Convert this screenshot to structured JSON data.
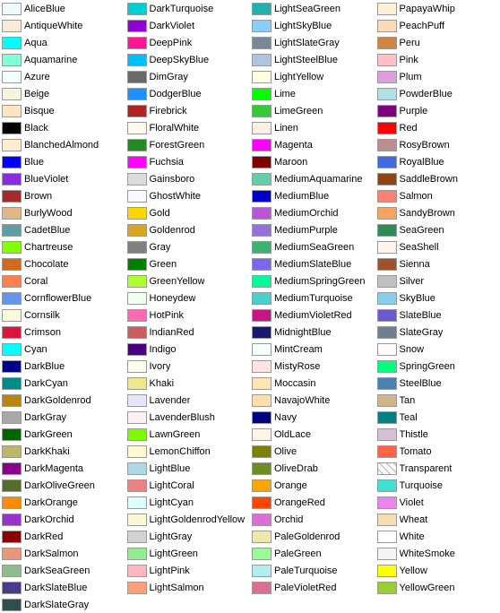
{
  "columns": [
    [
      {
        "name": "AliceBlue",
        "color": "#F0F8FF"
      },
      {
        "name": "AntiqueWhite",
        "color": "#FAEBD7"
      },
      {
        "name": "Aqua",
        "color": "#00FFFF"
      },
      {
        "name": "Aquamarine",
        "color": "#7FFFD4"
      },
      {
        "name": "Azure",
        "color": "#F0FFFF"
      },
      {
        "name": "Beige",
        "color": "#F5F5DC"
      },
      {
        "name": "Bisque",
        "color": "#FFE4C4"
      },
      {
        "name": "Black",
        "color": "#000000"
      },
      {
        "name": "BlanchedAlmond",
        "color": "#FFEBCD"
      },
      {
        "name": "Blue",
        "color": "#0000FF"
      },
      {
        "name": "BlueViolet",
        "color": "#8A2BE2"
      },
      {
        "name": "Brown",
        "color": "#A52A2A"
      },
      {
        "name": "BurlyWood",
        "color": "#DEB887"
      },
      {
        "name": "CadetBlue",
        "color": "#5F9EA0"
      },
      {
        "name": "Chartreuse",
        "color": "#7FFF00"
      },
      {
        "name": "Chocolate",
        "color": "#D2691E"
      },
      {
        "name": "Coral",
        "color": "#FF7F50"
      },
      {
        "name": "CornflowerBlue",
        "color": "#6495ED"
      },
      {
        "name": "Cornsilk",
        "color": "#FFF8DC"
      },
      {
        "name": "Crimson",
        "color": "#DC143C"
      },
      {
        "name": "Cyan",
        "color": "#00FFFF"
      },
      {
        "name": "DarkBlue",
        "color": "#00008B"
      },
      {
        "name": "DarkCyan",
        "color": "#008B8B"
      },
      {
        "name": "DarkGoldenrod",
        "color": "#B8860B"
      },
      {
        "name": "DarkGray",
        "color": "#A9A9A9"
      },
      {
        "name": "DarkGreen",
        "color": "#006400"
      },
      {
        "name": "DarkKhaki",
        "color": "#BDB76B"
      },
      {
        "name": "DarkMagenta",
        "color": "#8B008B"
      },
      {
        "name": "DarkOliveGreen",
        "color": "#556B2F"
      },
      {
        "name": "DarkOrange",
        "color": "#FF8C00"
      },
      {
        "name": "DarkOrchid",
        "color": "#9932CC"
      },
      {
        "name": "DarkRed",
        "color": "#8B0000"
      },
      {
        "name": "DarkSalmon",
        "color": "#E9967A"
      },
      {
        "name": "DarkSeaGreen",
        "color": "#8FBC8F"
      },
      {
        "name": "DarkSlateBlue",
        "color": "#483D8B"
      },
      {
        "name": "DarkSlateGray",
        "color": "#2F4F4F"
      }
    ],
    [
      {
        "name": "DarkTurquoise",
        "color": "#00CED1"
      },
      {
        "name": "DarkViolet",
        "color": "#9400D3"
      },
      {
        "name": "DeepPink",
        "color": "#FF1493"
      },
      {
        "name": "DeepSkyBlue",
        "color": "#00BFFF"
      },
      {
        "name": "DimGray",
        "color": "#696969"
      },
      {
        "name": "DodgerBlue",
        "color": "#1E90FF"
      },
      {
        "name": "Firebrick",
        "color": "#B22222"
      },
      {
        "name": "FloralWhite",
        "color": "#FFFAF0"
      },
      {
        "name": "ForestGreen",
        "color": "#228B22"
      },
      {
        "name": "Fuchsia",
        "color": "#FF00FF"
      },
      {
        "name": "Gainsboro",
        "color": "#DCDCDC"
      },
      {
        "name": "GhostWhite",
        "color": "#F8F8FF"
      },
      {
        "name": "Gold",
        "color": "#FFD700"
      },
      {
        "name": "Goldenrod",
        "color": "#DAA520"
      },
      {
        "name": "Gray",
        "color": "#808080"
      },
      {
        "name": "Green",
        "color": "#008000"
      },
      {
        "name": "GreenYellow",
        "color": "#ADFF2F"
      },
      {
        "name": "Honeydew",
        "color": "#F0FFF0"
      },
      {
        "name": "HotPink",
        "color": "#FF69B4"
      },
      {
        "name": "IndianRed",
        "color": "#CD5C5C"
      },
      {
        "name": "Indigo",
        "color": "#4B0082"
      },
      {
        "name": "Ivory",
        "color": "#FFFFF0"
      },
      {
        "name": "Khaki",
        "color": "#F0E68C"
      },
      {
        "name": "Lavender",
        "color": "#E6E6FA"
      },
      {
        "name": "LavenderBlush",
        "color": "#FFF0F5"
      },
      {
        "name": "LawnGreen",
        "color": "#7CFC00"
      },
      {
        "name": "LemonChiffon",
        "color": "#FFFACD"
      },
      {
        "name": "LightBlue",
        "color": "#ADD8E6"
      },
      {
        "name": "LightCoral",
        "color": "#F08080"
      },
      {
        "name": "LightCyan",
        "color": "#E0FFFF"
      },
      {
        "name": "LightGoldenrodYellow",
        "color": "#FAFAD2"
      },
      {
        "name": "LightGray",
        "color": "#D3D3D3"
      },
      {
        "name": "LightGreen",
        "color": "#90EE90"
      },
      {
        "name": "LightPink",
        "color": "#FFB6C1"
      },
      {
        "name": "LightSalmon",
        "color": "#FFA07A"
      },
      {
        "name": ""
      }
    ],
    [
      {
        "name": "LightSeaGreen",
        "color": "#20B2AA"
      },
      {
        "name": "LightSkyBlue",
        "color": "#87CEFA"
      },
      {
        "name": "LightSlateGray",
        "color": "#778899"
      },
      {
        "name": "LightSteelBlue",
        "color": "#B0C4DE"
      },
      {
        "name": "LightYellow",
        "color": "#FFFFE0"
      },
      {
        "name": "Lime",
        "color": "#00FF00"
      },
      {
        "name": "LimeGreen",
        "color": "#32CD32"
      },
      {
        "name": "Linen",
        "color": "#FAF0E6"
      },
      {
        "name": "Magenta",
        "color": "#FF00FF"
      },
      {
        "name": "Maroon",
        "color": "#800000"
      },
      {
        "name": "MediumAquamarine",
        "color": "#66CDAA"
      },
      {
        "name": "MediumBlue",
        "color": "#0000CD"
      },
      {
        "name": "MediumOrchid",
        "color": "#BA55D3"
      },
      {
        "name": "MediumPurple",
        "color": "#9370DB"
      },
      {
        "name": "MediumSeaGreen",
        "color": "#3CB371"
      },
      {
        "name": "MediumSlateBlue",
        "color": "#7B68EE"
      },
      {
        "name": "MediumSpringGreen",
        "color": "#00FA9A"
      },
      {
        "name": "MediumTurquoise",
        "color": "#48D1CC"
      },
      {
        "name": "MediumVioletRed",
        "color": "#C71585"
      },
      {
        "name": "MidnightBlue",
        "color": "#191970"
      },
      {
        "name": "MintCream",
        "color": "#F5FFFA"
      },
      {
        "name": "MistyRose",
        "color": "#FFE4E1"
      },
      {
        "name": "Moccasin",
        "color": "#FFE4B5"
      },
      {
        "name": "NavajoWhite",
        "color": "#FFDEAD"
      },
      {
        "name": "Navy",
        "color": "#000080"
      },
      {
        "name": "OldLace",
        "color": "#FDF5E6"
      },
      {
        "name": "Olive",
        "color": "#808000"
      },
      {
        "name": "OliveDrab",
        "color": "#6B8E23"
      },
      {
        "name": "Orange",
        "color": "#FFA500"
      },
      {
        "name": "OrangeRed",
        "color": "#FF4500"
      },
      {
        "name": "Orchid",
        "color": "#DA70D6"
      },
      {
        "name": "PaleGoldenrod",
        "color": "#EEE8AA"
      },
      {
        "name": "PaleGreen",
        "color": "#98FB98"
      },
      {
        "name": "PaleTurquoise",
        "color": "#AFEEEE"
      },
      {
        "name": "PaleVioletRed",
        "color": "#DB7093"
      },
      {
        "name": ""
      }
    ],
    [
      {
        "name": "PapayaWhip",
        "color": "#FFEFD5"
      },
      {
        "name": "PeachPuff",
        "color": "#FFDAB9"
      },
      {
        "name": "Peru",
        "color": "#CD853F"
      },
      {
        "name": "Pink",
        "color": "#FFC0CB"
      },
      {
        "name": "Plum",
        "color": "#DDA0DD"
      },
      {
        "name": "PowderBlue",
        "color": "#B0E0E6"
      },
      {
        "name": "Purple",
        "color": "#800080"
      },
      {
        "name": "Red",
        "color": "#FF0000"
      },
      {
        "name": "RosyBrown",
        "color": "#BC8F8F"
      },
      {
        "name": "RoyalBlue",
        "color": "#4169E1"
      },
      {
        "name": "SaddleBrown",
        "color": "#8B4513"
      },
      {
        "name": "Salmon",
        "color": "#FA8072"
      },
      {
        "name": "SandyBrown",
        "color": "#F4A460"
      },
      {
        "name": "SeaGreen",
        "color": "#2E8B57"
      },
      {
        "name": "SeaShell",
        "color": "#FFF5EE"
      },
      {
        "name": "Sienna",
        "color": "#A0522D"
      },
      {
        "name": "Silver",
        "color": "#C0C0C0"
      },
      {
        "name": "SkyBlue",
        "color": "#87CEEB"
      },
      {
        "name": "SlateBlue",
        "color": "#6A5ACD"
      },
      {
        "name": "SlateGray",
        "color": "#708090"
      },
      {
        "name": "Snow",
        "color": "#FFFAFA"
      },
      {
        "name": "SpringGreen",
        "color": "#00FF7F"
      },
      {
        "name": "SteelBlue",
        "color": "#4682B4"
      },
      {
        "name": "Tan",
        "color": "#D2B48C"
      },
      {
        "name": "Teal",
        "color": "#008080"
      },
      {
        "name": "Thistle",
        "color": "#D8BFD8"
      },
      {
        "name": "Tomato",
        "color": "#FF6347"
      },
      {
        "name": "Transparent",
        "color": "transparent"
      },
      {
        "name": "Turquoise",
        "color": "#40E0D0"
      },
      {
        "name": "Violet",
        "color": "#EE82EE"
      },
      {
        "name": "Wheat",
        "color": "#F5DEB3"
      },
      {
        "name": "White",
        "color": "#FFFFFF"
      },
      {
        "name": "WhiteSmoke",
        "color": "#F5F5F5"
      },
      {
        "name": "Yellow",
        "color": "#FFFF00"
      },
      {
        "name": "YellowGreen",
        "color": "#9ACD32"
      },
      {
        "name": ""
      }
    ]
  ]
}
